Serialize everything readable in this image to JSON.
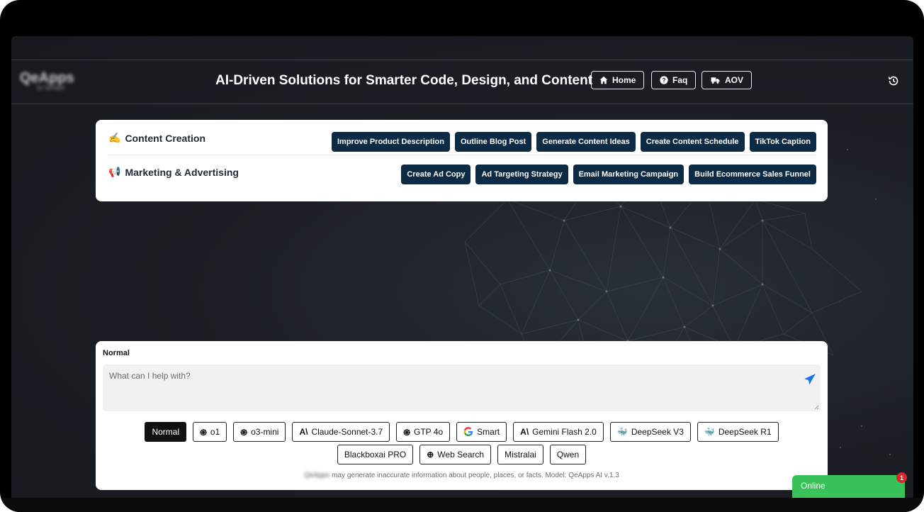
{
  "header": {
    "logo_text": "QeApps",
    "logo_sub": "by QeApps",
    "title": "AI-Driven Solutions for Smarter Code, Design, and Content",
    "nav": [
      {
        "label": "Home",
        "icon": "home-icon"
      },
      {
        "label": "Faq",
        "icon": "question-circle-icon"
      },
      {
        "label": "AOV",
        "icon": "truck-icon"
      }
    ],
    "history_icon": "history-icon"
  },
  "categories": [
    {
      "label": "Content Creation",
      "icon": "pencil-emoji-icon",
      "actions": [
        "Improve Product Description",
        "Outline Blog Post",
        "Generate Content Ideas",
        "Create Content Schedule",
        "TikTok Caption"
      ]
    },
    {
      "label": "Marketing & Advertising",
      "icon": "megaphone-icon",
      "actions": [
        "Create Ad Copy",
        "Ad Targeting Strategy",
        "Email Marketing Campaign",
        "Build Ecommerce Sales Funnel"
      ]
    }
  ],
  "composer": {
    "mode_label": "Normal",
    "placeholder": "What can I help with?",
    "value": "",
    "send_icon": "paper-plane-icon"
  },
  "models": {
    "selected": "Normal",
    "row1": [
      {
        "label": "Normal",
        "icon": ""
      },
      {
        "label": "o1",
        "icon": "openai-icon"
      },
      {
        "label": "o3-mini",
        "icon": "openai-icon"
      },
      {
        "label": "Claude-Sonnet-3.7",
        "icon": "anthropic-icon"
      },
      {
        "label": "GTP 4o",
        "icon": "openai-icon"
      },
      {
        "label": "Smart",
        "icon": "google-icon"
      },
      {
        "label": "Gemini Flash 2.0",
        "icon": "anthropic-icon"
      },
      {
        "label": "DeepSeek V3",
        "icon": "deepseek-whale-icon"
      },
      {
        "label": "DeepSeek R1",
        "icon": "deepseek-whale-icon"
      }
    ],
    "row2": [
      {
        "label": "Blackboxai PRO",
        "icon": ""
      },
      {
        "label": "Web Search",
        "icon": "globe-icon"
      },
      {
        "label": "Mistralai",
        "icon": ""
      },
      {
        "label": "Qwen",
        "icon": ""
      }
    ]
  },
  "footnote": {
    "brand": "QeApps",
    "text": " may generate inaccurate information about people, places, or facts. Model: QeApps AI v.1.3"
  },
  "chat_widget": {
    "status": "Online",
    "badge_count": "1"
  },
  "colors": {
    "chip_bg": "#0d2b45",
    "online_green": "#39c15a",
    "badge_red": "#d9262b",
    "send_blue": "#1a73e8"
  }
}
